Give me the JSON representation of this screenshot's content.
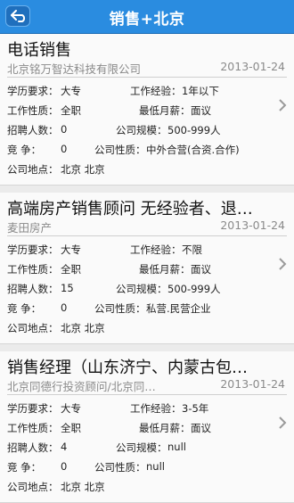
{
  "header": {
    "title": "销售+北京"
  },
  "jobs": [
    {
      "title": "电话销售",
      "company": "北京铭万智达科技有限公司",
      "date": "2013-01-24",
      "rows": [
        {
          "l": "学历要求：",
          "v": "大专",
          "rl": "工作经验：",
          "rv": "1年以下"
        },
        {
          "l": "工作性质：",
          "v": "全职",
          "rl": "最低月薪：",
          "rv": "面议"
        },
        {
          "l": "招聘人数：",
          "v": "0",
          "rl": "公司规模：",
          "rv": "500-999人"
        },
        {
          "l": "竞      争：",
          "v": "0",
          "rl": "公司性质：",
          "rv": "中外合营(合资.合作)"
        },
        {
          "l": "公司地点：",
          "v": "北京 北京",
          "rl": "",
          "rv": ""
        }
      ]
    },
    {
      "title": "高端房产销售顾问 无经验者、退…",
      "company": "麦田房产",
      "date": "2013-01-24",
      "rows": [
        {
          "l": "学历要求：",
          "v": "大专",
          "rl": "工作经验：",
          "rv": "不限"
        },
        {
          "l": "工作性质：",
          "v": "全职",
          "rl": "最低月薪：",
          "rv": "面议"
        },
        {
          "l": "招聘人数：",
          "v": "15",
          "rl": "公司规模：",
          "rv": "500-999人"
        },
        {
          "l": "竞      争：",
          "v": "0",
          "rl": "公司性质：",
          "rv": "私营.民营企业"
        },
        {
          "l": "公司地点：",
          "v": "北京 北京",
          "rl": "",
          "rv": ""
        }
      ]
    },
    {
      "title": "销售经理（山东济宁、内蒙古包…",
      "company": "北京同德行投资顾问/北京同…",
      "date": "2013-01-24",
      "rows": [
        {
          "l": "学历要求：",
          "v": "大专",
          "rl": "工作经验：",
          "rv": "3-5年"
        },
        {
          "l": "工作性质：",
          "v": "全职",
          "rl": "最低月薪：",
          "rv": "面议"
        },
        {
          "l": "招聘人数：",
          "v": "4",
          "rl": "公司规模：",
          "rv": "null"
        },
        {
          "l": "竞      争：",
          "v": "0",
          "rl": "公司性质：",
          "rv": "null"
        },
        {
          "l": "公司地点：",
          "v": "北京 北京",
          "rl": "",
          "rv": ""
        }
      ]
    }
  ]
}
